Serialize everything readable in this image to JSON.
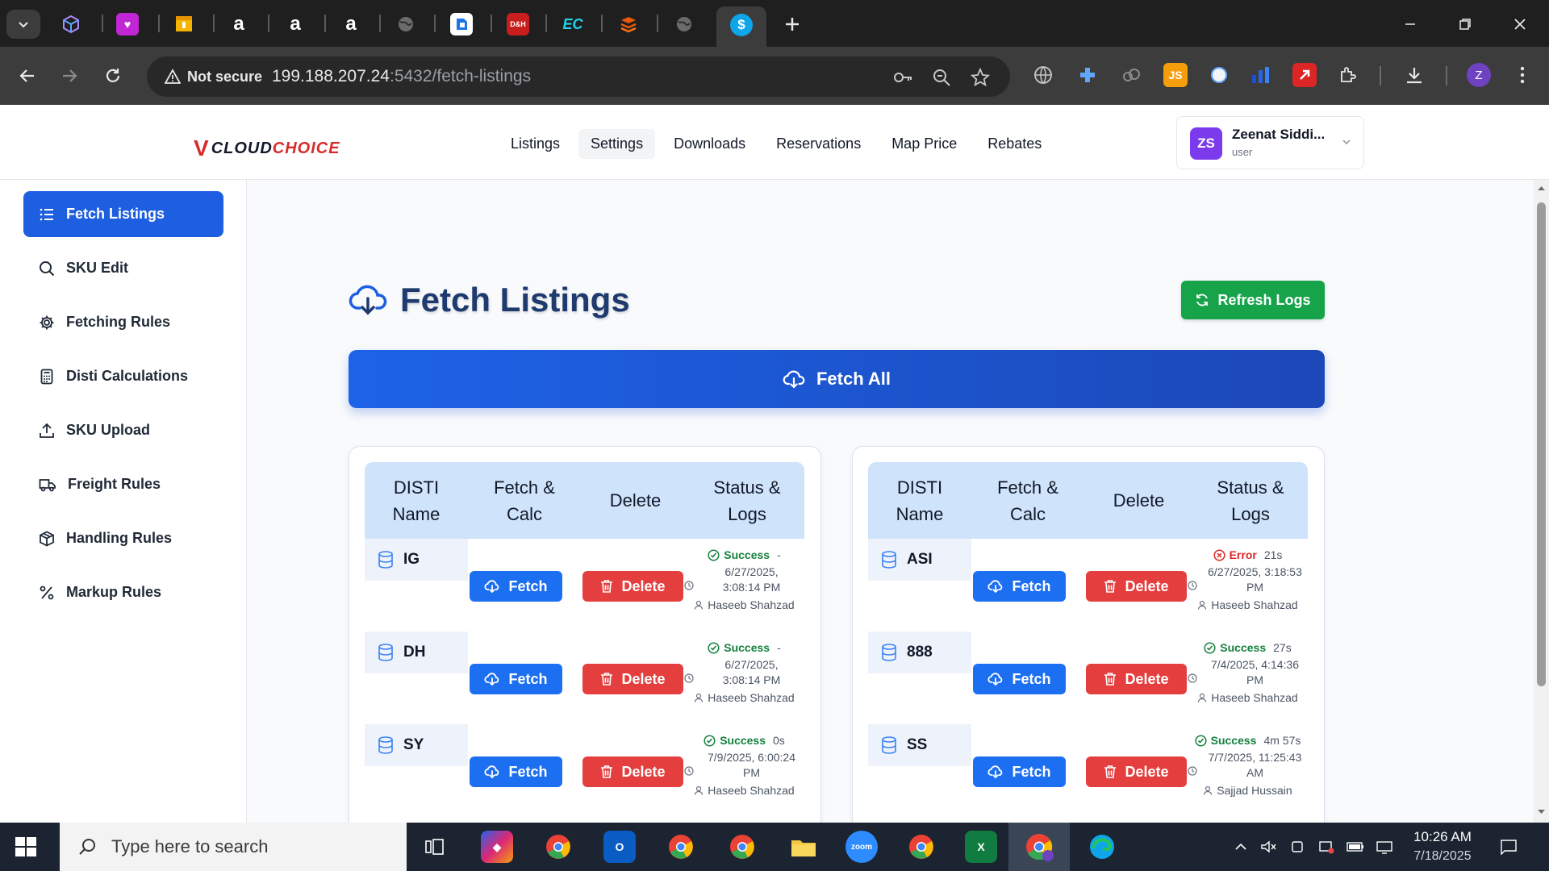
{
  "browser": {
    "not_secure_label": "Not secure",
    "url_host": "199.188.207.24",
    "url_path": ":5432/fetch-listings",
    "profile_initial": "Z"
  },
  "header": {
    "logo_v": "V",
    "logo_cloud": "CLOUD",
    "logo_choice": "CHOICE",
    "nav": [
      {
        "label": "Listings"
      },
      {
        "label": "Settings"
      },
      {
        "label": "Downloads"
      },
      {
        "label": "Reservations"
      },
      {
        "label": "Map Price"
      },
      {
        "label": "Rebates"
      }
    ],
    "user": {
      "initials": "ZS",
      "name": "Zeenat Siddi...",
      "role": "user"
    }
  },
  "sidebar": {
    "items": [
      {
        "label": "Fetch Listings",
        "icon": "list-icon"
      },
      {
        "label": "SKU Edit",
        "icon": "search-icon"
      },
      {
        "label": "Fetching Rules",
        "icon": "gear-icon"
      },
      {
        "label": "Disti Calculations",
        "icon": "calculator-icon"
      },
      {
        "label": "SKU Upload",
        "icon": "upload-icon"
      },
      {
        "label": "Freight Rules",
        "icon": "truck-icon"
      },
      {
        "label": "Handling Rules",
        "icon": "package-icon"
      },
      {
        "label": "Markup Rules",
        "icon": "percent-icon"
      }
    ]
  },
  "main": {
    "title": "Fetch Listings",
    "refresh_label": "Refresh Logs",
    "fetch_all_label": "Fetch All",
    "columns": {
      "name_1": "DISTI",
      "name_2": "Name",
      "fetch_1": "Fetch &",
      "fetch_2": "Calc",
      "delete": "Delete",
      "status_1": "Status &",
      "status_2": "Logs"
    },
    "fetch_label": "Fetch",
    "delete_label": "Delete",
    "left_rows": [
      {
        "name": "IG",
        "status": "Success",
        "duration": "-",
        "date": "6/27/2025,",
        "time": "3:08:14 PM",
        "user": "Haseeb Shahzad"
      },
      {
        "name": "DH",
        "status": "Success",
        "duration": "-",
        "date": "6/27/2025,",
        "time": "3:08:14 PM",
        "user": "Haseeb Shahzad"
      },
      {
        "name": "SY",
        "status": "Success",
        "duration": "0s",
        "date": "7/9/2025, 6:00:24",
        "time": "PM",
        "user": "Haseeb Shahzad"
      }
    ],
    "right_rows": [
      {
        "name": "ASI",
        "status": "Error",
        "duration": "21s",
        "date": "6/27/2025, 3:18:53",
        "time": "PM",
        "user": "Haseeb Shahzad"
      },
      {
        "name": "888",
        "status": "Success",
        "duration": "27s",
        "date": "7/4/2025, 4:14:36",
        "time": "PM",
        "user": "Haseeb Shahzad"
      },
      {
        "name": "SS",
        "status": "Success",
        "duration": "4m 57s",
        "date": "7/7/2025, 11:25:43",
        "time": "AM",
        "user": "Sajjad Hussain"
      }
    ]
  },
  "taskbar": {
    "search_placeholder": "Type here to search",
    "time": "10:26 AM",
    "date": "7/18/2025"
  },
  "colors": {
    "primary": "#1d5fe0",
    "success": "#16a34a",
    "danger": "#e53e3e",
    "title": "#1e3a6e"
  }
}
